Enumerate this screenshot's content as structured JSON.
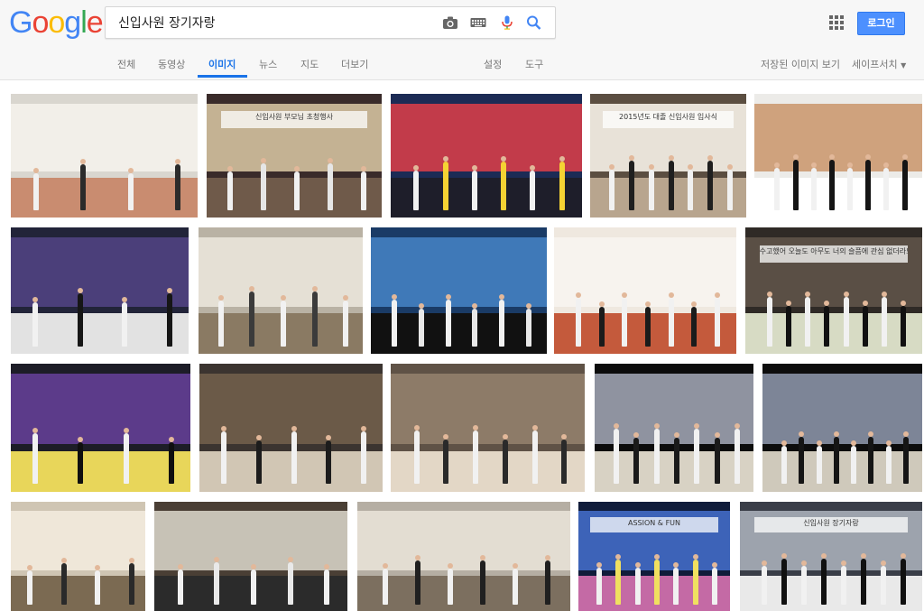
{
  "logo": {
    "letters": [
      "G",
      "o",
      "o",
      "g",
      "l",
      "e"
    ],
    "colors": [
      "#4285f4",
      "#ea4335",
      "#fbbc05",
      "#4285f4",
      "#34a853",
      "#ea4335"
    ]
  },
  "search": {
    "query": "신입사원 장기자랑"
  },
  "icons": {
    "camera": "camera-icon",
    "keyboard": "keyboard-icon",
    "mic": "microphone-icon",
    "search": "search-icon",
    "apps": "apps-grid-icon"
  },
  "header": {
    "login_label": "로그인"
  },
  "nav": {
    "tabs": [
      "전체",
      "동영상",
      "이미지",
      "뉴스",
      "지도",
      "더보기"
    ],
    "active": "이미지",
    "settings": "설정",
    "tools": "도구",
    "saved_images": "저장된 이미지 보기",
    "safesearch": "세이프서치"
  },
  "colors": {
    "accent": "#1a73e8",
    "login_bg": "#4d90fe",
    "header_bg": "#f7f7f7"
  },
  "results": {
    "banner_texts": [
      "신입사원 부모님 초청행사",
      "2015년도 대졸 신입사원 입사식",
      "수고했어 오늘도 아무도 너의 슬픔에 관심 없더라도",
      "ASSION & FUN",
      "신입사원 장기자랑"
    ]
  }
}
